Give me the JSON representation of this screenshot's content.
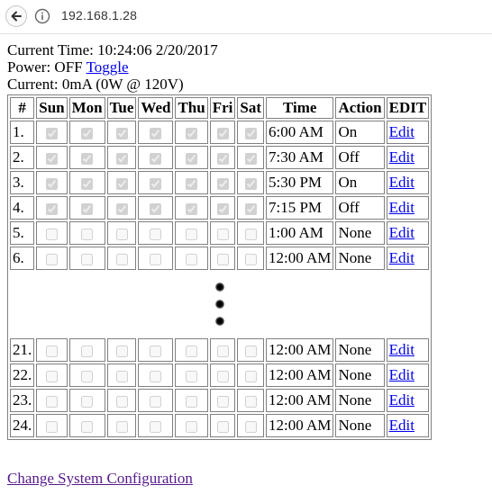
{
  "browser": {
    "url": "192.168.1.28"
  },
  "status": {
    "current_time_label": "Current Time:",
    "current_time_value": "10:24:06 2/20/2017",
    "power_label": "Power:",
    "power_value": "OFF",
    "toggle_link": "Toggle",
    "current_label": "Current:",
    "current_value": "0mA (0W @ 120V)"
  },
  "table": {
    "headers": [
      "#",
      "Sun",
      "Mon",
      "Tue",
      "Wed",
      "Thu",
      "Fri",
      "Sat",
      "Time",
      "Action",
      "EDIT"
    ],
    "rows_top": [
      {
        "num": "1.",
        "days": [
          true,
          true,
          true,
          true,
          true,
          true,
          true
        ],
        "time": "6:00 AM",
        "action": "On",
        "edit": "Edit"
      },
      {
        "num": "2.",
        "days": [
          true,
          true,
          true,
          true,
          true,
          true,
          true
        ],
        "time": "7:30 AM",
        "action": "Off",
        "edit": "Edit"
      },
      {
        "num": "3.",
        "days": [
          true,
          true,
          true,
          true,
          true,
          true,
          true
        ],
        "time": "5:30 PM",
        "action": "On",
        "edit": "Edit"
      },
      {
        "num": "4.",
        "days": [
          true,
          true,
          true,
          true,
          true,
          true,
          true
        ],
        "time": "7:15 PM",
        "action": "Off",
        "edit": "Edit"
      },
      {
        "num": "5.",
        "days": [
          false,
          false,
          false,
          false,
          false,
          false,
          false
        ],
        "time": "1:00 AM",
        "action": "None",
        "edit": "Edit"
      },
      {
        "num": "6.",
        "days": [
          false,
          false,
          false,
          false,
          false,
          false,
          false
        ],
        "time": "12:00 AM",
        "action": "None",
        "edit": "Edit"
      }
    ],
    "rows_bottom": [
      {
        "num": "21.",
        "days": [
          false,
          false,
          false,
          false,
          false,
          false,
          false
        ],
        "time": "12:00 AM",
        "action": "None",
        "edit": "Edit"
      },
      {
        "num": "22.",
        "days": [
          false,
          false,
          false,
          false,
          false,
          false,
          false
        ],
        "time": "12:00 AM",
        "action": "None",
        "edit": "Edit"
      },
      {
        "num": "23.",
        "days": [
          false,
          false,
          false,
          false,
          false,
          false,
          false
        ],
        "time": "12:00 AM",
        "action": "None",
        "edit": "Edit"
      },
      {
        "num": "24.",
        "days": [
          false,
          false,
          false,
          false,
          false,
          false,
          false
        ],
        "time": "12:00 AM",
        "action": "None",
        "edit": "Edit"
      }
    ]
  },
  "footer": {
    "config_link": "Change System Configuration"
  },
  "colors": {
    "link": "#0000ee",
    "visited_link": "#551a8b",
    "table_border": "#808080"
  }
}
